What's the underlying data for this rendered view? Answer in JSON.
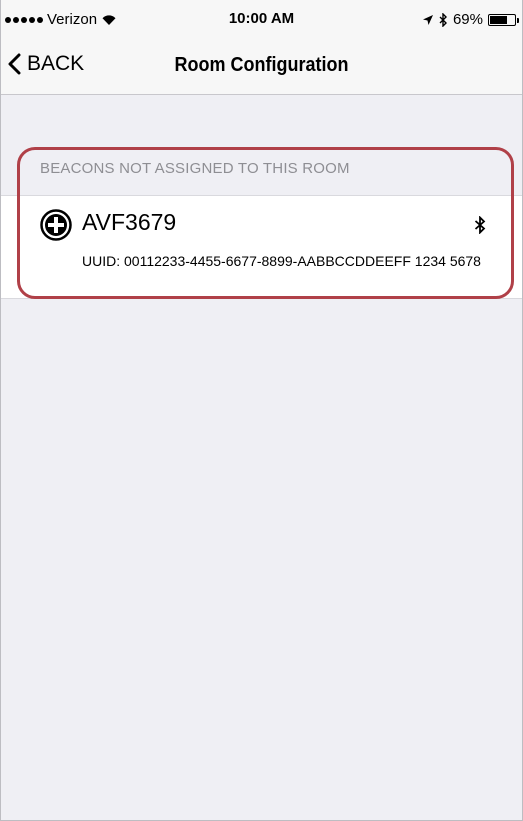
{
  "status_bar": {
    "carrier": "Verizon",
    "time": "10:00 AM",
    "battery_percent": "69%",
    "battery_level": 0.69
  },
  "nav": {
    "back_label": "BACK",
    "title": "Room Configuration"
  },
  "section": {
    "header": "BEACONS NOT ASSIGNED TO THIS ROOM",
    "beacons": [
      {
        "name": "AVF3679",
        "uuid": "UUID: 00112233-4455-6677-8899-AABBCCDDEEFF 1234 5678"
      }
    ]
  },
  "colors": {
    "highlight": "#b04048",
    "background": "#efeff4",
    "section_header": "#8e8e93"
  },
  "icons": {
    "add": "plus-circle-icon",
    "bluetooth": "bluetooth-icon",
    "back": "chevron-left-icon",
    "wifi": "wifi-icon",
    "location": "location-arrow-icon",
    "battery": "battery-icon"
  }
}
